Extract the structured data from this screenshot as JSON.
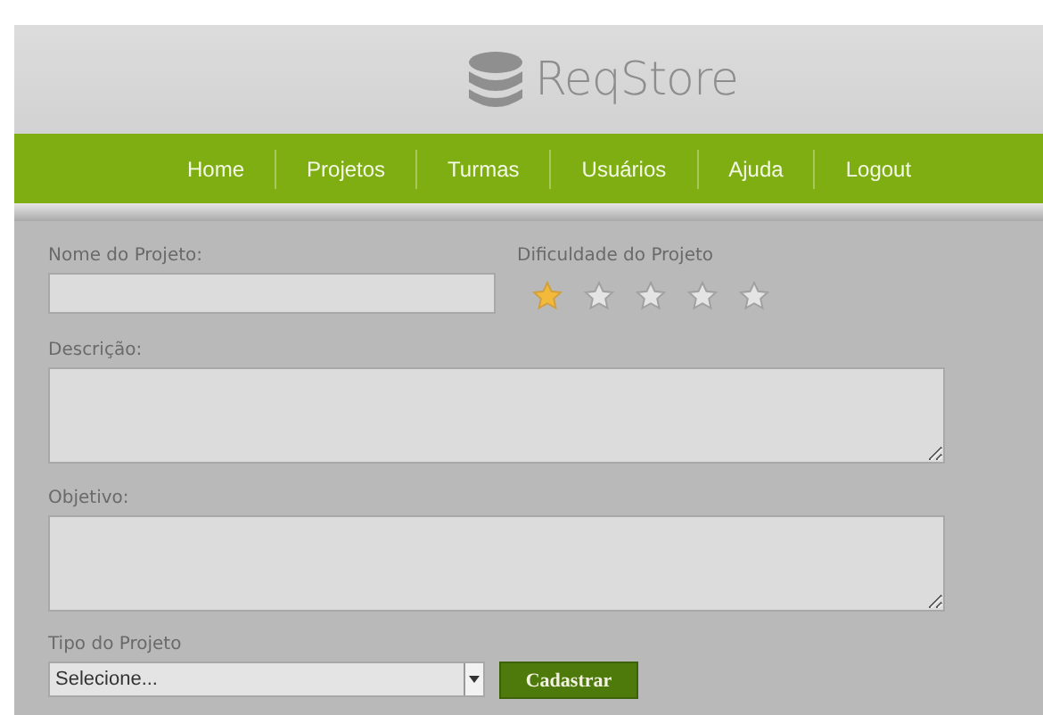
{
  "logo": {
    "text": "ReqStore"
  },
  "nav": [
    {
      "label": "Home"
    },
    {
      "label": "Projetos"
    },
    {
      "label": "Turmas"
    },
    {
      "label": "Usuários"
    },
    {
      "label": "Ajuda"
    },
    {
      "label": "Logout"
    }
  ],
  "form": {
    "name_label": "Nome do Projeto:",
    "difficulty_label": "Dificuldade do Projeto",
    "difficulty": {
      "stars": 1
    },
    "description_label": "Descrição:",
    "objective_label": "Objetivo:",
    "type_label": "Tipo do Projeto",
    "type_select": {
      "value": "Selecione..."
    },
    "submit": "Cadastrar"
  }
}
